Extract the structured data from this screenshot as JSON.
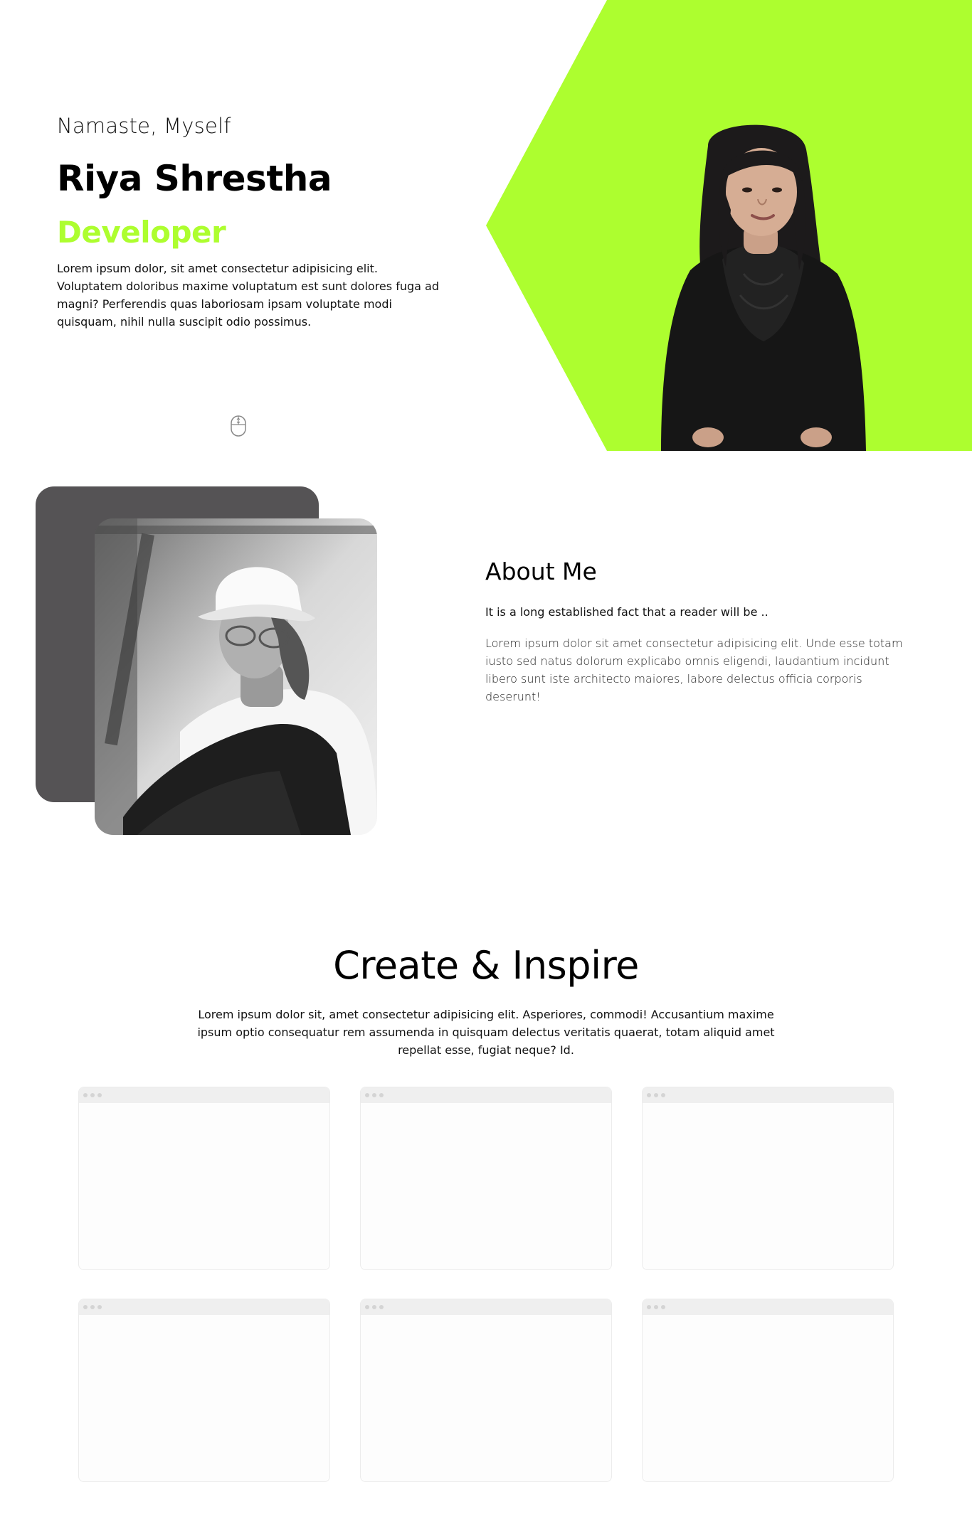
{
  "hero": {
    "greeting": "Namaste, Myself",
    "name": "Riya Shrestha",
    "role": "Developer",
    "description": "Lorem ipsum dolor, sit amet consectetur adipisicing elit. Voluptatem doloribus maxime voluptatum est sunt dolores fuga ad magni? Perferendis quas laboriosam ipsam voluptate modi quisquam, nihil nulla suscipit odio possimus.",
    "scroll_icon": "mouse-scroll-icon"
  },
  "about": {
    "title": "About Me",
    "subtitle": "It is a long established fact that a reader will be ..",
    "paragraph": "Lorem ipsum dolor sit amet consectetur adipisicing elit. Unde esse totam iusto sed natus dolorum explicabo omnis eligendi, laudantium incidunt libero sunt iste architecto maiores, labore delectus officia corporis deserunt!"
  },
  "projects": {
    "title": "Create & Inspire",
    "description": "Lorem ipsum dolor sit, amet consectetur adipisicing elit. Asperiores, commodi! Accusantium maxime ipsum optio consequatur rem assumenda in quisquam delectus veritatis quaerat, totam aliquid amet repellat esse, fugiat neque? Id.",
    "card_count": 6
  },
  "colors": {
    "accent": "#adfe2f",
    "dark_card": "#555355",
    "text": "#000000"
  }
}
